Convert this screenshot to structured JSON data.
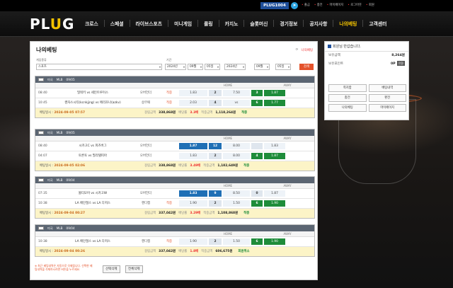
{
  "topbar": {
    "site_code": "PLUG1004",
    "telegram_icon": "telegram-icon",
    "links": [
      "출금",
      "충전",
      "마이페이지",
      "로그아웃",
      "회원"
    ]
  },
  "header": {
    "logo_main": "PL",
    "logo_accent": "U",
    "logo_end": "G",
    "nav": [
      "크로스",
      "스페셜",
      "라이브스포츠",
      "미니게임",
      "롤링",
      "카지노",
      "슬롯머신",
      "경기정보",
      "공지사항",
      "나의베팅",
      "고객센터"
    ],
    "active_nav": "나의베팅"
  },
  "panel": {
    "title": "나의베팅",
    "tools": [
      "⟳",
      "나의베팅"
    ],
    "filter": {
      "type_label": "게임종류",
      "type_value": "스포츠",
      "period_label": "기간",
      "start_year": "2024년",
      "start_month": "09월",
      "start_day": "05일",
      "end_year": "2024년",
      "end_month": "09월",
      "end_day": "05일",
      "search_label": "검색"
    }
  },
  "bets": [
    {
      "league": "미국",
      "sport": "MLB",
      "date": "09/05",
      "sub": [
        "",
        "",
        "",
        "",
        "HOME",
        "",
        "",
        "AWAY"
      ],
      "rows": [
        {
          "time": "08:40",
          "team": "밀워키 vs 세인트루이스",
          "type": "오버언더",
          "result": "적중",
          "home": "1.83",
          "mid": "2",
          "line": "7.50",
          "cnt": "3",
          "away": "1.87",
          "home_sel": false,
          "cnt_lite": false,
          "away_lite": false
        },
        {
          "time": "10:45",
          "team": "캔자스시티(kcnkjjng) vs 애리조나(azkv)",
          "type": "승무패",
          "result": "적중",
          "home": "2.03",
          "mid": "4",
          "line": "vs",
          "cnt": "6",
          "away": "1.77",
          "home_sel": false,
          "cnt_lite": false,
          "away_lite": false
        }
      ],
      "summary": {
        "date_label": "배팅일시",
        "date": "2024-09-05 07:57",
        "amount_label": "걸림금액",
        "amount": "338,868원",
        "odds_label": "배당률",
        "odds": "3.3배",
        "win_label": "적중금액",
        "win": "1,118,264원",
        "result": "적중"
      }
    },
    {
      "league": "미국",
      "sport": "MLB",
      "date": "09/05",
      "sub": [
        "",
        "",
        "",
        "",
        "HOME",
        "",
        "",
        "AWAY"
      ],
      "rows": [
        {
          "time": "08:40",
          "team": "시카고C vs 피츠버그",
          "type": "오버언더",
          "result": "",
          "home": "1.87",
          "mid": "12",
          "line": "8.00",
          "cnt": "",
          "away": "1.83",
          "home_sel": true,
          "cnt_lite": true,
          "away_lite": true
        },
        {
          "time": "04:07",
          "team": "토론토 vs 필라델피아",
          "type": "오버언더",
          "result": "",
          "home": "1.83",
          "mid": "2",
          "line": "8.00",
          "cnt": "4",
          "away": "1.87",
          "home_sel": false,
          "cnt_lite": false,
          "away_lite": false
        }
      ],
      "summary": {
        "date_label": "배팅일시",
        "date": "2024-09-05 02:06",
        "amount_label": "걸림금액",
        "amount": "338,868원",
        "odds_label": "배당률",
        "odds": "3.49배",
        "win_label": "적중금액",
        "win": "1,182,649원",
        "result": "적중"
      }
    },
    {
      "league": "미국",
      "sport": "MLB",
      "date": "09/04",
      "sub": [
        "",
        "",
        "",
        "",
        "HOME",
        "",
        "",
        "AWAY"
      ],
      "rows": [
        {
          "time": "07:35",
          "team": "볼티모어 vs 시카고W",
          "type": "오버언더",
          "result": "",
          "home": "1.83",
          "mid": "9",
          "line": "8.50",
          "cnt": "0",
          "away": "1.87",
          "home_sel": true,
          "cnt_lite": true,
          "away_lite": true
        },
        {
          "time": "10:38",
          "team": "LA 에인절스 vs LA 다저스",
          "type": "핸디캡",
          "result": "적중",
          "home": "1.90",
          "mid": "2",
          "line": "1.50",
          "cnt": "6",
          "away": "1.90",
          "home_sel": false,
          "cnt_lite": false,
          "away_lite": false
        }
      ],
      "summary": {
        "date_label": "배팅일시",
        "date": "2024-09-04 00:27",
        "amount_label": "걸림금액",
        "amount": "337,042원",
        "odds_label": "배당률",
        "odds": "3.29배",
        "win_label": "적중금액",
        "win": "1,108,868원",
        "result": "적중"
      }
    },
    {
      "league": "미국",
      "sport": "MLB",
      "date": "09/04",
      "sub": [
        "",
        "",
        "",
        "",
        "HOME",
        "",
        "",
        "AWAY"
      ],
      "rows": [
        {
          "time": "10:38",
          "team": "LA 에인절스 vs LA 다저스",
          "type": "핸디캡",
          "result": "적중",
          "home": "1.90",
          "mid": "2",
          "line": "1.50",
          "cnt": "6",
          "away": "1.90",
          "home_sel": false,
          "cnt_lite": false,
          "away_lite": false
        }
      ],
      "summary": {
        "date_label": "배팅일시",
        "date": "2024-09-04 00:26",
        "amount_label": "걸림금액",
        "amount": "337,042원",
        "odds_label": "배당률",
        "odds": "1.8배",
        "win_label": "적중금액",
        "win": "606,675원",
        "result": "회원취소"
      }
    }
  ],
  "bottom": {
    "notice": "※ 최근 베팅내역은 자동으로 삭제됩니다. 선택한 베팅내역을 삭제하시려면 버튼을 누르세요.",
    "select_delete": "선택삭제",
    "delete_all": "전체삭제"
  },
  "user": {
    "greeting": "회원님 반갑습니다.",
    "balance_label": "보유금액",
    "balance": "8,264원",
    "points_label": "보유포인트",
    "points": "0P",
    "convert": "전환",
    "buttons": [
      "쪽지함",
      "베팅내역",
      "충전",
      "환전",
      "나의베팅",
      "마이페이지"
    ]
  }
}
